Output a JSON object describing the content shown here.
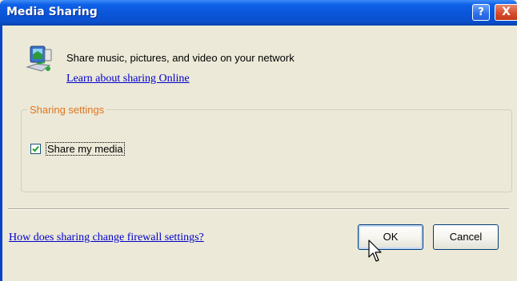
{
  "window": {
    "title": "Media Sharing",
    "help_label": "?",
    "close_label": "X"
  },
  "header": {
    "description": "Share music, pictures, and video on your network",
    "learn_link": "Learn about sharing Online"
  },
  "sharing_settings": {
    "legend": "Sharing settings",
    "share_media_label": "Share my media",
    "share_media_checked": true
  },
  "footer": {
    "firewall_link": "How does sharing change firewall settings?",
    "ok_label": "OK",
    "cancel_label": "Cancel"
  },
  "colors": {
    "titlebar": "#0a55d9",
    "dialog_bg": "#ece9d8",
    "link": "#0000cc",
    "legend": "#e0751f"
  }
}
